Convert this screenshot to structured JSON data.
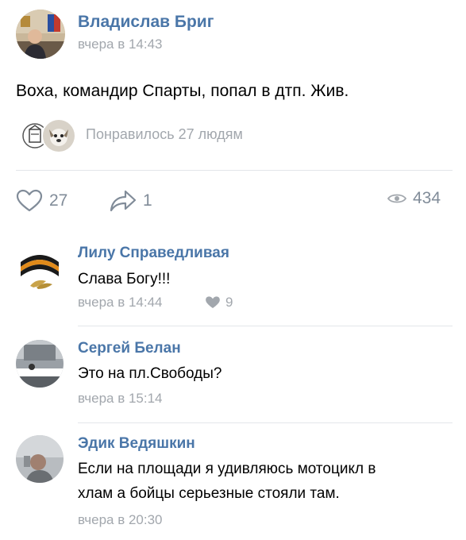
{
  "post": {
    "author": "Владислав Бриг",
    "time": "вчера в 14:43",
    "text": "Воха, командир Спарты, попал в дтп. Жив.",
    "likers_text": "Понравилось 27 людям",
    "likes_count": "27",
    "shares_count": "1",
    "views_count": "434"
  },
  "comments": [
    {
      "author": "Лилу Справедливая",
      "text": "Слава Богу!!!",
      "time": "вчера в 14:44",
      "likes": "9"
    },
    {
      "author": "Сергей Белан",
      "text": "Это на пл.Свободы?",
      "time": "вчера в 15:14"
    },
    {
      "author": "Эдик Ведяшкин",
      "text_line1": "Если на площади я удивляюсь мотоцикл в",
      "text_line2": "хлам а бойцы серьезные стояли там.",
      "time": "вчера в 20:30"
    }
  ],
  "icons": {
    "like": "heart-icon",
    "share": "share-arrow-icon",
    "views": "eye-icon",
    "comment_like": "small-heart-icon"
  },
  "colors": {
    "link": "#4a76a8",
    "secondary": "#a2a7ad",
    "action": "#818c99",
    "divider": "#e3e6ea"
  }
}
